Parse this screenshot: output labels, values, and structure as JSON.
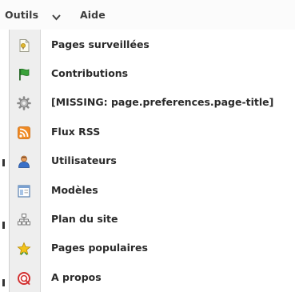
{
  "menubar": {
    "outils_label": "Outils",
    "aide_label": "Aide"
  },
  "menu": {
    "items": [
      {
        "label": "Pages surveillées",
        "icon": "watched-pages-icon"
      },
      {
        "label": "Contributions",
        "icon": "flag-icon"
      },
      {
        "label": "[MISSING: page.preferences.page-title]",
        "icon": "gear-icon"
      },
      {
        "label": "Flux RSS",
        "icon": "rss-icon"
      },
      {
        "label": "Utilisateurs",
        "icon": "user-icon"
      },
      {
        "label": "Modèles",
        "icon": "template-icon"
      },
      {
        "label": "Plan du site",
        "icon": "sitemap-icon"
      },
      {
        "label": "Pages populaires",
        "icon": "star-icon"
      },
      {
        "label": "A propos",
        "icon": "about-icon"
      }
    ]
  }
}
